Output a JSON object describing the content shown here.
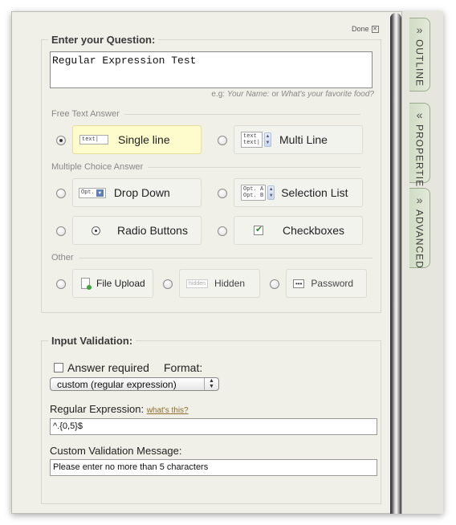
{
  "done": {
    "label": "Done"
  },
  "question": {
    "legend": "Enter your Question:",
    "value": "Regular Expression Test",
    "hint_prefix": "e.g:",
    "hint_ex1": "Your Name:",
    "hint_or": "or",
    "hint_ex2": "What's your favorite food?"
  },
  "sections": {
    "free_text": "Free Text Answer",
    "multiple_choice": "Multiple Choice Answer",
    "other": "Other"
  },
  "options": {
    "single_line": {
      "label": "Single line",
      "icon_text": "text|",
      "selected": true
    },
    "multi_line": {
      "label": "Multi Line",
      "icon_text_1": "text",
      "icon_text_2": "text|"
    },
    "drop_down": {
      "label": "Drop Down",
      "icon_text": "Opt."
    },
    "selection_list": {
      "label": "Selection List",
      "icon_text_1": "Opt. A",
      "icon_text_2": "Opt. B"
    },
    "radio_buttons": {
      "label": "Radio Buttons"
    },
    "checkboxes": {
      "label": "Checkboxes"
    },
    "file_upload": {
      "label": "File Upload"
    },
    "hidden": {
      "label": "Hidden",
      "icon_text": "hidden"
    },
    "password": {
      "label": "Password",
      "icon_text": "•••"
    }
  },
  "validation": {
    "legend": "Input Validation:",
    "answer_required_label": "Answer required",
    "answer_required_checked": false,
    "format_label": "Format:",
    "format_value": "custom (regular expression)",
    "regex_label": "Regular Expression:",
    "regex_help_link": "what's this?",
    "regex_value": "^.{0,5}$",
    "message_label": "Custom Validation Message:",
    "message_value": "Please enter no more than 5 characters"
  },
  "side_tabs": [
    {
      "label": "OUTLINE"
    },
    {
      "label": "PROPERTIES"
    },
    {
      "label": "ADVANCED"
    }
  ]
}
